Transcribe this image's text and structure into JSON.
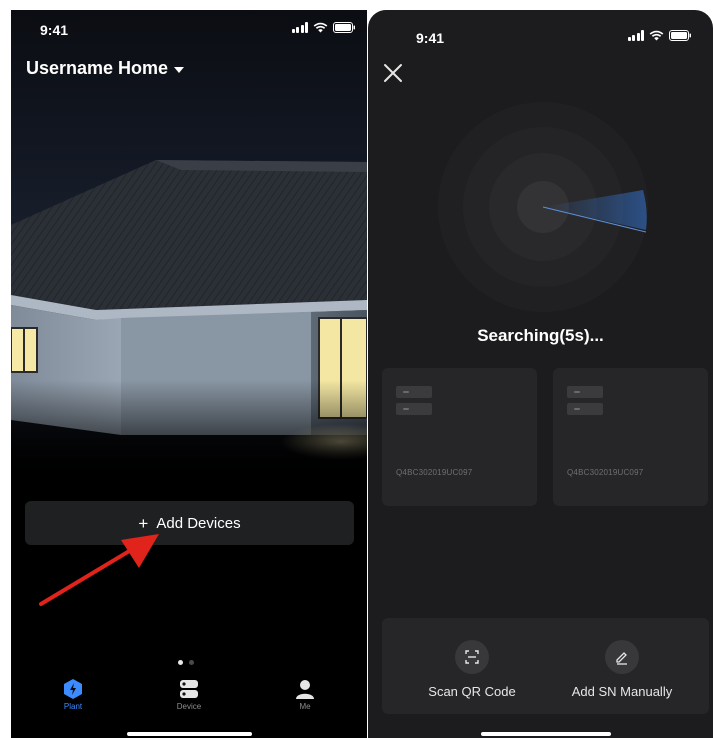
{
  "left_screen": {
    "status": {
      "time": "9:41"
    },
    "home_title": "Username Home",
    "add_devices": {
      "plus": "+",
      "label": "Add Devices"
    },
    "tabs": [
      {
        "label": "Plant",
        "icon": "plant-icon",
        "active": true
      },
      {
        "label": "Device",
        "icon": "device-icon",
        "active": false
      },
      {
        "label": "Me",
        "icon": "me-icon",
        "active": false
      }
    ]
  },
  "right_screen": {
    "status": {
      "time": "9:41"
    },
    "searching_label": "Searching(5s)...",
    "devices": [
      {
        "sn": "Q4BC302019UC097"
      },
      {
        "sn": "Q4BC302019UC097"
      }
    ],
    "actions": {
      "scan_label": "Scan QR Code",
      "manual_label": "Add SN Manually"
    }
  },
  "colors": {
    "accent": "#3c8bff",
    "annotation_arrow": "#e0241b",
    "card_bg": "#262628",
    "screen_bg": "#1c1c1e"
  }
}
